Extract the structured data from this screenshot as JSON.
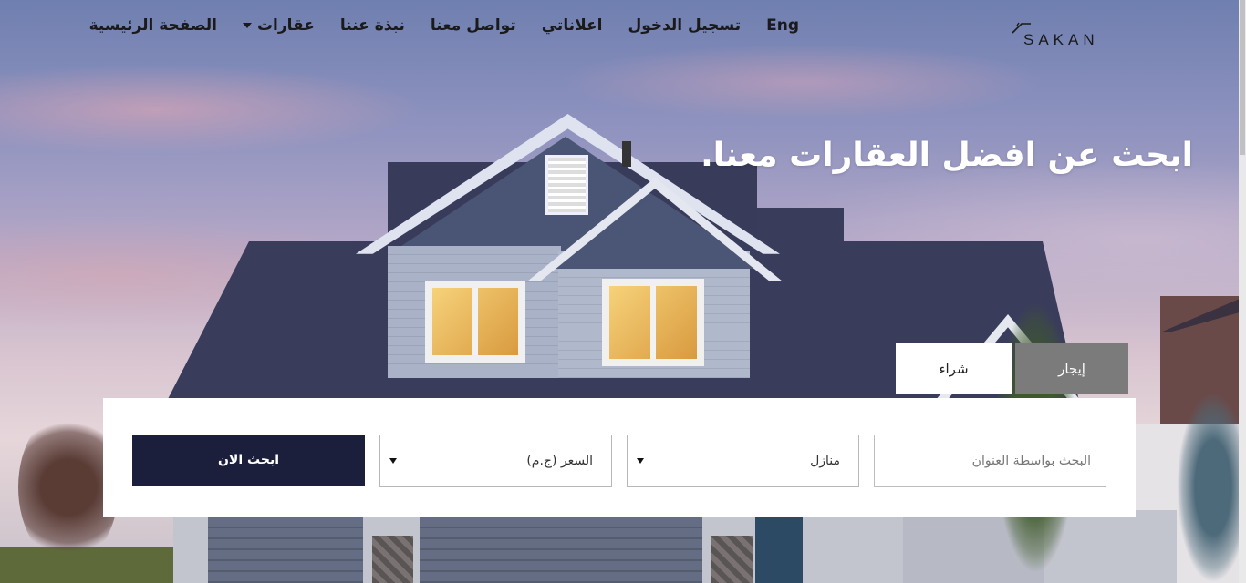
{
  "brand": {
    "logo_text": "SAKAN"
  },
  "nav": {
    "home": "الصفحة الرئيسية",
    "properties": "عقارات",
    "about": "نبذة عننا",
    "contact": "تواصل معنا",
    "my_ads": "اعلاناتي",
    "login": "تسجيل الدخول",
    "language": "Eng"
  },
  "hero": {
    "title": "ابحث عن افضل العقارات معنا."
  },
  "tabs": {
    "rent": "إيجار",
    "buy": "شراء"
  },
  "search": {
    "address_placeholder": "البحث بواسطة العنوان",
    "type_value": "منازل",
    "price_value": "السعر (ج.م)",
    "submit_label": "ابحث الان"
  },
  "colors": {
    "primary": "#1c1f3c",
    "tab_active": "#7b7b7b",
    "text": "#1a1a1a"
  }
}
